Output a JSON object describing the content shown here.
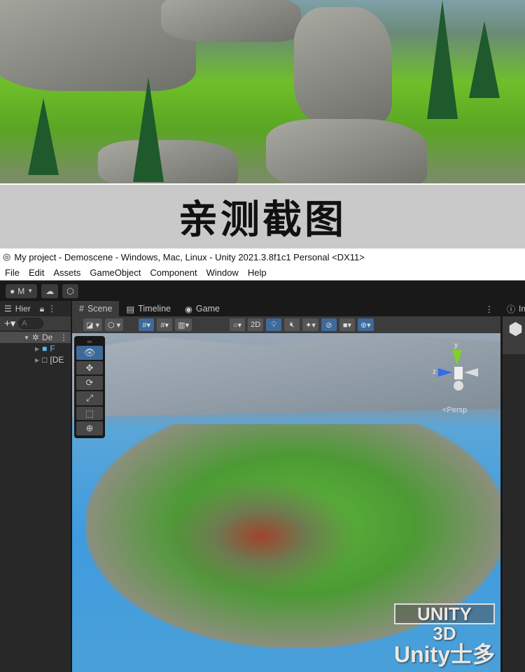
{
  "banner": {
    "text": "亲测截图"
  },
  "window": {
    "title": "My project - Demoscene - Windows, Mac, Linux - Unity 2021.3.8f1c1 Personal <DX11>"
  },
  "menu": [
    "File",
    "Edit",
    "Assets",
    "GameObject",
    "Component",
    "Window",
    "Help"
  ],
  "toolbar": {
    "account_label": "M"
  },
  "hierarchy": {
    "tab_label": "Hier",
    "search_placeholder": "A",
    "scene_item": "De",
    "children": [
      "F",
      "[DE"
    ]
  },
  "scene_tabs": [
    {
      "label": "Scene"
    },
    {
      "label": "Timeline"
    },
    {
      "label": "Game"
    }
  ],
  "scene_toolbar": {
    "mode_2d": "2D"
  },
  "gizmo": {
    "y_label": "y",
    "z_label": "z",
    "projection": "<Persp"
  },
  "inspector": {
    "tab_label": "In"
  },
  "watermark": {
    "line1": "UNITY",
    "line2": "3D",
    "line3": "Unity士多"
  }
}
